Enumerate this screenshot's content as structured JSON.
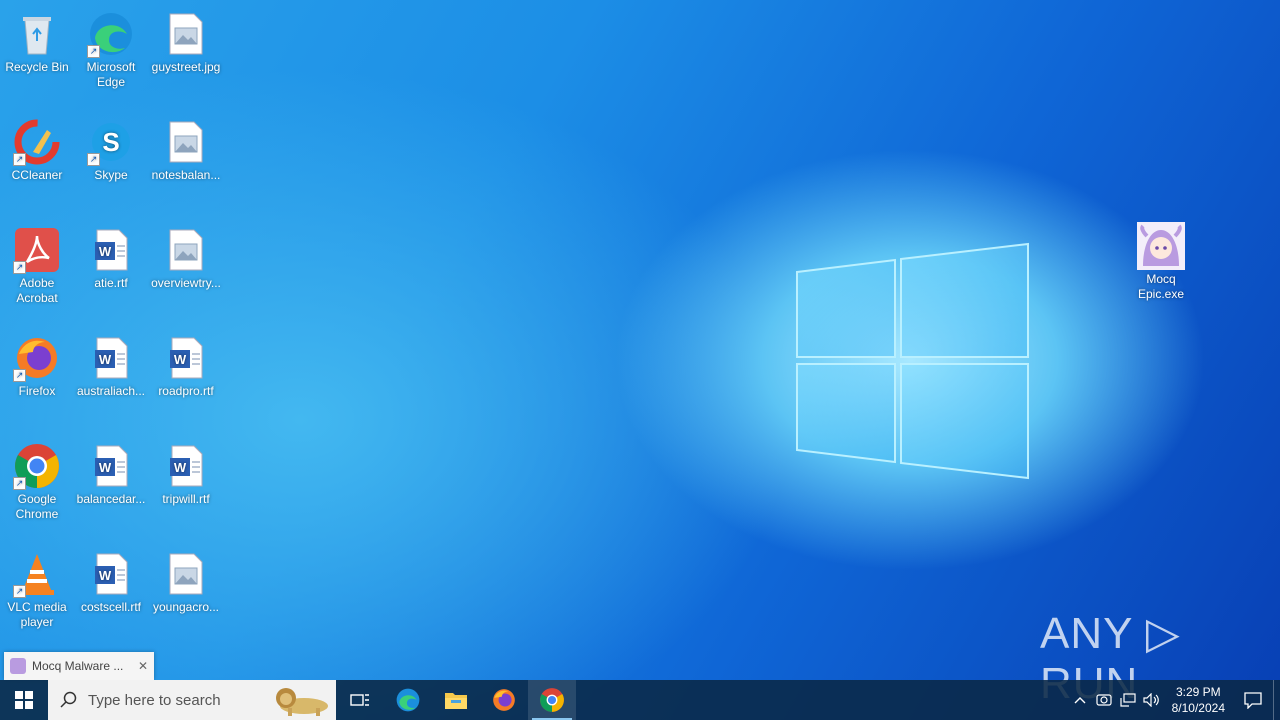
{
  "desktop": {
    "icons": [
      {
        "label": "Recycle Bin",
        "icon": "recycle-bin-icon"
      },
      {
        "label": "Microsoft Edge",
        "icon": "edge-icon"
      },
      {
        "label": "guystreet.jpg",
        "icon": "image-file-icon"
      },
      {
        "label": "CCleaner",
        "icon": "ccleaner-icon"
      },
      {
        "label": "Skype",
        "icon": "skype-icon"
      },
      {
        "label": "notesbalan...",
        "icon": "image-file-icon"
      },
      {
        "label": "Adobe Acrobat",
        "icon": "acrobat-icon"
      },
      {
        "label": "atie.rtf",
        "icon": "word-doc-icon"
      },
      {
        "label": "overviewtry...",
        "icon": "image-file-icon"
      },
      {
        "label": "Firefox",
        "icon": "firefox-icon"
      },
      {
        "label": "australiach...",
        "icon": "word-doc-icon"
      },
      {
        "label": "roadpro.rtf",
        "icon": "word-doc-icon"
      },
      {
        "label": "Google Chrome",
        "icon": "chrome-icon"
      },
      {
        "label": "balancedar...",
        "icon": "word-doc-icon"
      },
      {
        "label": "tripwill.rtf",
        "icon": "word-doc-icon"
      },
      {
        "label": "VLC media player",
        "icon": "vlc-icon"
      },
      {
        "label": "costscell.rtf",
        "icon": "word-doc-icon"
      },
      {
        "label": "youngacro...",
        "icon": "image-file-icon"
      },
      {
        "label": "Mocq Epic.exe",
        "icon": "anime-app-icon"
      }
    ]
  },
  "watermark": {
    "text": "ANY ▷ RUN"
  },
  "thumbnail": {
    "title": "Mocq Malware ...",
    "close": "✕"
  },
  "taskbar": {
    "search_placeholder": "Type here to search",
    "time": "3:29 PM",
    "date": "8/10/2024"
  }
}
